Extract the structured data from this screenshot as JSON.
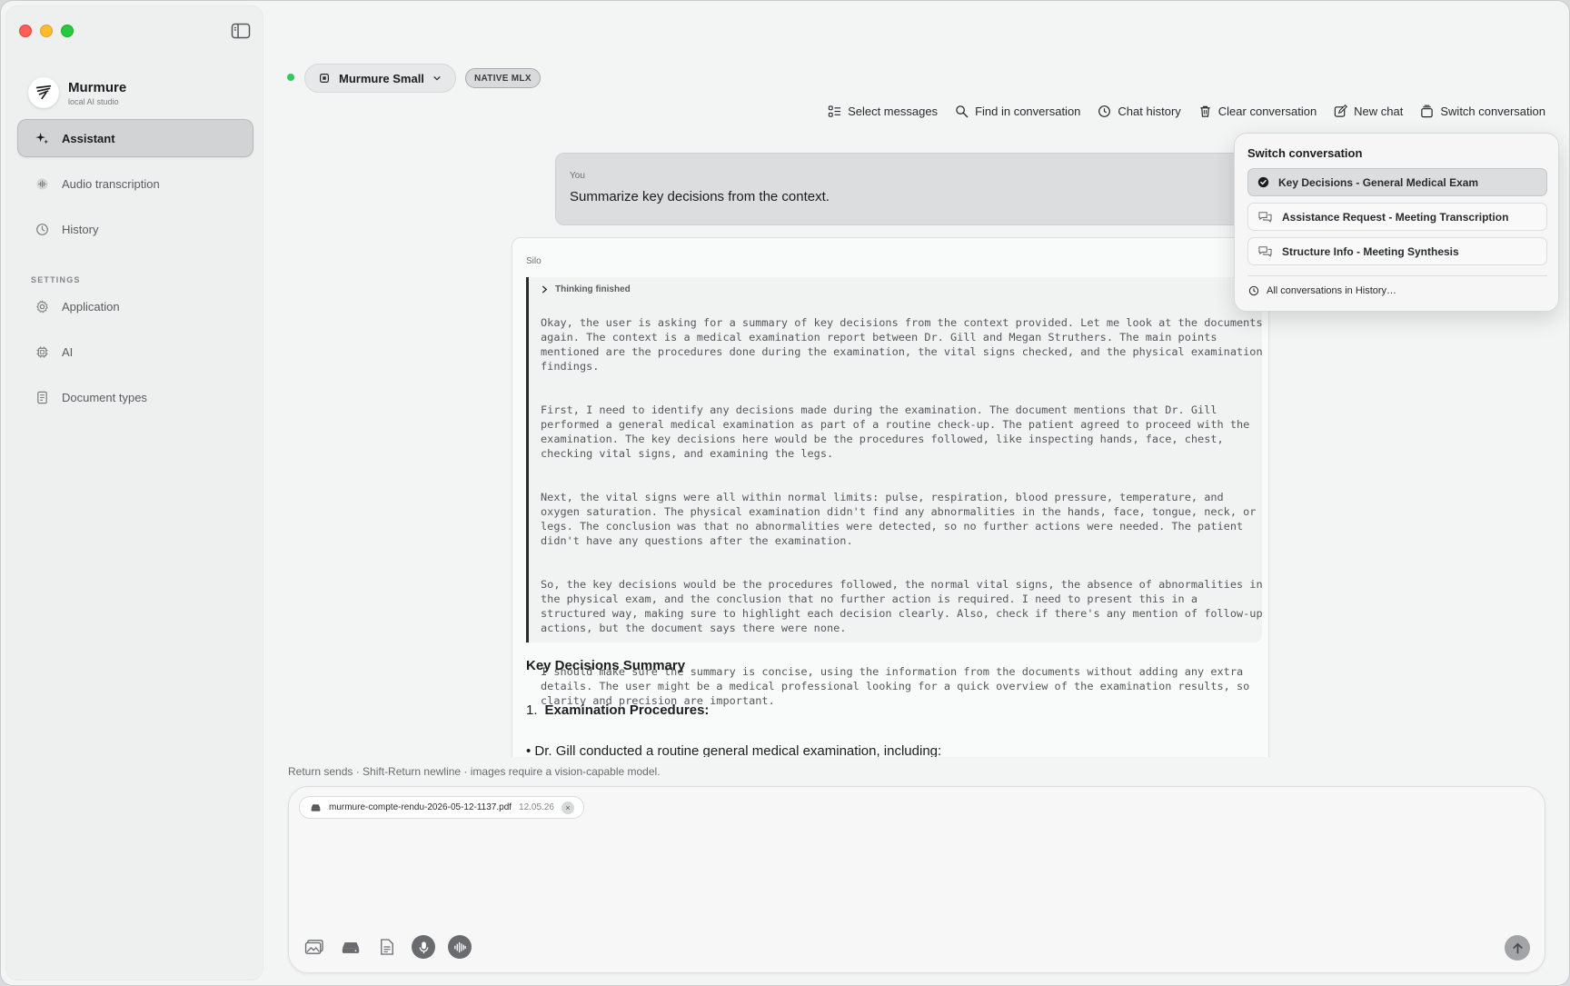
{
  "app": {
    "name": "Murmure",
    "subtitle": "local AI studio"
  },
  "sidebar": {
    "items": [
      {
        "label": "Assistant",
        "icon": "sparkle-icon",
        "active": true
      },
      {
        "label": "Audio transcription",
        "icon": "waveform-icon",
        "active": false
      },
      {
        "label": "History",
        "icon": "clock-icon",
        "active": false
      }
    ],
    "settings_label": "SETTINGS",
    "settings_items": [
      {
        "label": "Application",
        "icon": "gear-icon"
      },
      {
        "label": "AI",
        "icon": "chip-icon"
      },
      {
        "label": "Document types",
        "icon": "document-icon"
      }
    ]
  },
  "model": {
    "name": "Murmure Small",
    "badge": "NATIVE MLX",
    "status_color": "#34c759"
  },
  "toolbar": {
    "select_messages": "Select messages",
    "find": "Find in conversation",
    "history": "Chat history",
    "clear": "Clear conversation",
    "new_chat": "New chat",
    "switch": "Switch conversation"
  },
  "chat": {
    "user_label": "You",
    "user_message": "Summarize key decisions from the context.",
    "assistant_label": "Silo",
    "thinking_label": "Thinking finished",
    "thinking_paragraphs": [
      "Okay, the user is asking for a summary of key decisions from the context provided. Let me look at the documents again. The context is a medical examination report between Dr. Gill and Megan Struthers. The main points mentioned are the procedures done during the examination, the vital signs checked, and the physical examination findings.",
      "First, I need to identify any decisions made during the examination. The document mentions that Dr. Gill performed a general medical examination as part of a routine check-up. The patient agreed to proceed with the examination. The key decisions here would be the procedures followed, like inspecting hands, face, chest, checking vital signs, and examining the legs.",
      "Next, the vital signs were all within normal limits: pulse, respiration, blood pressure, temperature, and oxygen saturation. The physical examination didn't find any abnormalities in the hands, face, tongue, neck, or legs. The conclusion was that no abnormalities were detected, so no further actions were needed. The patient didn't have any questions after the examination.",
      "So, the key decisions would be the procedures followed, the normal vital signs, the absence of abnormalities in the physical exam, and the conclusion that no further action is required. I need to present this in a structured way, making sure to highlight each decision clearly. Also, check if there's any mention of follow-up actions, but the document says there were none.",
      "I should make sure the summary is concise, using the information from the documents without adding any extra details. The user might be a medical professional looking for a quick overview of the examination results, so clarity and precision are important."
    ],
    "summary_title": "Key Decisions Summary",
    "summary_number": "1.",
    "summary_item": "Examination Procedures:",
    "summary_clip": "Dr. Gill conducted a routine general medical examination, including:"
  },
  "composer": {
    "hint": "Return sends · Shift-Return newline · images require a vision-capable model.",
    "attachment_name": "murmure-compte-rendu-2026-05-12-1137.pdf",
    "attachment_date": "12.05.26",
    "remove_glyph": "×"
  },
  "popover": {
    "title": "Switch conversation",
    "items": [
      {
        "label": "Key Decisions - General Medical Exam",
        "selected": true
      },
      {
        "label": "Assistance Request - Meeting Transcription",
        "selected": false
      },
      {
        "label": "Structure Info - Meeting Synthesis",
        "selected": false
      }
    ],
    "footer": "All conversations in History…"
  }
}
